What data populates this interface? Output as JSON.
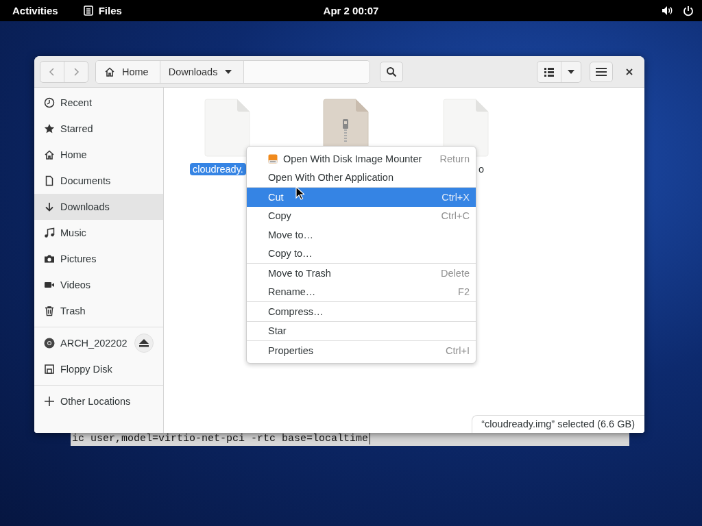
{
  "top_bar": {
    "activities": "Activities",
    "app": "Files",
    "clock": "Apr 2  00:07"
  },
  "terminal": {
    "text": "ic user,model=virtio-net-pci -rtc base=localtime"
  },
  "window": {
    "path": [
      {
        "label": "Home",
        "selected": false
      },
      {
        "label": "Downloads",
        "selected": true
      }
    ]
  },
  "sidebar": {
    "items": [
      {
        "label": "Recent",
        "selected": false
      },
      {
        "label": "Starred",
        "selected": false
      },
      {
        "label": "Home",
        "selected": false
      },
      {
        "label": "Documents",
        "selected": false
      },
      {
        "label": "Downloads",
        "selected": true
      },
      {
        "label": "Music",
        "selected": false
      },
      {
        "label": "Pictures",
        "selected": false
      },
      {
        "label": "Videos",
        "selected": false
      },
      {
        "label": "Trash",
        "selected": false
      }
    ],
    "devices": [
      {
        "label": "ARCH_202202",
        "selected": false,
        "kind": "disc"
      },
      {
        "label": "Floppy Disk",
        "selected": false,
        "kind": "floppy"
      }
    ],
    "other": {
      "label": "Other Locations"
    }
  },
  "files": [
    {
      "label": "cloudready.",
      "selected": true,
      "kind": "blank"
    },
    {
      "kind": "zip"
    },
    {
      "label": "o",
      "selected": false,
      "kind": "blank"
    }
  ],
  "context_menu": {
    "sections": [
      [
        {
          "label": "Open With Disk Image Mounter",
          "shortcut": "Return",
          "selected": false,
          "kind": "icon"
        },
        {
          "label": "Open With Other Application",
          "selected": false,
          "kind": "plain"
        }
      ],
      [
        {
          "label": "Cut",
          "shortcut": "Ctrl+X",
          "selected": true,
          "kind": "plain"
        },
        {
          "label": "Copy",
          "shortcut": "Ctrl+C",
          "selected": false,
          "kind": "plain"
        },
        {
          "label": "Move to…",
          "selected": false,
          "kind": "plain"
        },
        {
          "label": "Copy to…",
          "selected": false,
          "kind": "plain"
        }
      ],
      [
        {
          "label": "Move to Trash",
          "shortcut": "Delete",
          "selected": false,
          "kind": "plain"
        },
        {
          "label": "Rename…",
          "shortcut": "F2",
          "selected": false,
          "kind": "plain"
        }
      ],
      [
        {
          "label": "Compress…",
          "selected": false,
          "kind": "plain"
        }
      ],
      [
        {
          "label": "Star",
          "selected": false,
          "kind": "plain"
        }
      ],
      [
        {
          "label": "Properties",
          "shortcut": "Ctrl+I",
          "selected": false,
          "kind": "plain"
        }
      ]
    ]
  },
  "status": {
    "text": "“cloudready.img” selected  (6.6 GB)"
  }
}
